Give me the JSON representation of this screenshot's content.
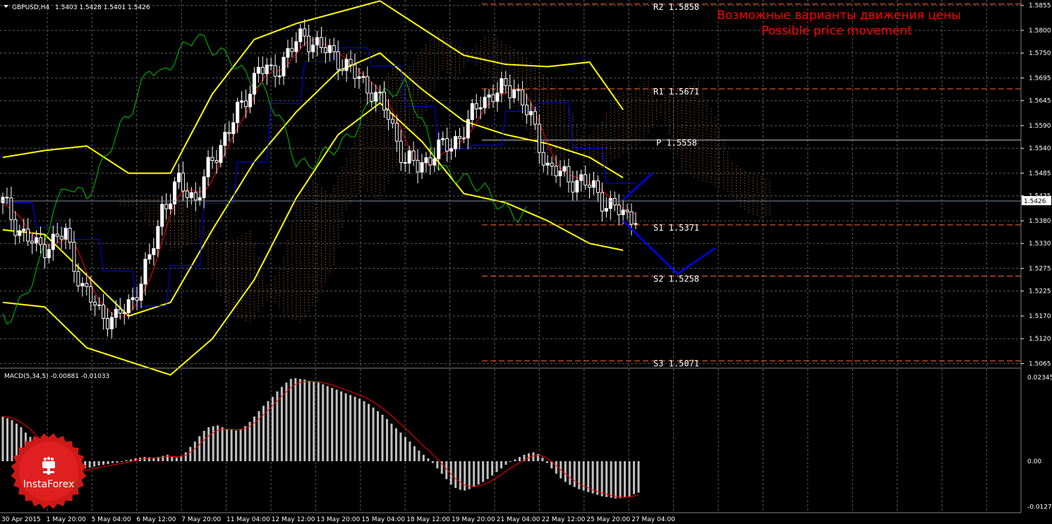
{
  "header": {
    "symbol_label": "GBPUSD,H4",
    "ohlc": "1.5403 1.5428 1.5401 1.5426",
    "dropdown_icon": "triangle-down-icon"
  },
  "annotations": {
    "title_ru": "Возможные варианты движения цены",
    "title_en": "Possible price movement",
    "color": "#ff0000"
  },
  "pivots": [
    {
      "label": "R2 1.5858",
      "value": 1.5858
    },
    {
      "label": "R1 1.5671",
      "value": 1.5671
    },
    {
      "label": "P 1.5558",
      "value": 1.5558
    },
    {
      "label": "S1 1.5371",
      "value": 1.5371
    },
    {
      "label": "S2 1.5258",
      "value": 1.5258
    },
    {
      "label": "S3 1.5071",
      "value": 1.5071
    }
  ],
  "current_price": "1.5426",
  "macd": {
    "label": "MACD(5,34,5) -0.00881 -0.01033",
    "ticks": [
      "0.02345",
      "0.00",
      "-0.0127"
    ]
  },
  "watermark": {
    "text": "InstaForex",
    "icon": "instaforex-logo-icon"
  },
  "colors": {
    "background": "#000000",
    "grid": "#5c5c5c",
    "bull_candle": "#ffffff",
    "bear_candle": "#ffffff",
    "bollinger": "#ffff00",
    "tenkan": "#ff0000",
    "kijun": "#0000ff",
    "chikou": "#00c000",
    "kumo": "#ff9966",
    "forecast": "#0000ff",
    "macd_hist": "#c0c0c0",
    "macd_signal": "#ff0000",
    "pivot": "#ff6633",
    "pivot_p": "#c0c0c0"
  },
  "chart_data": {
    "type": "line",
    "price_axis_ticks": [
      "1.5855",
      "1.5800",
      "1.5750",
      "1.5695",
      "1.5645",
      "1.5590",
      "1.5540",
      "1.5485",
      "1.5435",
      "1.5380",
      "1.5330",
      "1.5275",
      "1.5225",
      "1.5170",
      "1.5120",
      "1.5065"
    ],
    "time_axis_labels": [
      "30 Apr 2015",
      "1 May 20:00",
      "5 May 04:00",
      "6 May 12:00",
      "7 May 20:00",
      "11 May 04:00",
      "12 May 12:00",
      "13 May 20:00",
      "15 May 04:00",
      "18 May 12:00",
      "19 May 20:00",
      "21 May 04:00",
      "22 May 12:00",
      "25 May 20:00",
      "27 May 04:00"
    ],
    "ylim": [
      1.5055,
      1.5867
    ],
    "close_path": [
      [
        0,
        1.542
      ],
      [
        4,
        1.536
      ],
      [
        8,
        1.532
      ],
      [
        11,
        1.533
      ],
      [
        15,
        1.535
      ],
      [
        19,
        1.523
      ],
      [
        23,
        1.518
      ],
      [
        27,
        1.516
      ],
      [
        31,
        1.521
      ],
      [
        35,
        1.529
      ],
      [
        38,
        1.541
      ],
      [
        42,
        1.546
      ],
      [
        46,
        1.543
      ],
      [
        50,
        1.551
      ],
      [
        53,
        1.557
      ],
      [
        57,
        1.563
      ],
      [
        61,
        1.572
      ],
      [
        64,
        1.57
      ],
      [
        68,
        1.575
      ],
      [
        72,
        1.579
      ],
      [
        76,
        1.576
      ],
      [
        80,
        1.574
      ],
      [
        84,
        1.57
      ],
      [
        88,
        1.567
      ],
      [
        92,
        1.561
      ],
      [
        96,
        1.551
      ],
      [
        99,
        1.55
      ],
      [
        103,
        1.553
      ],
      [
        107,
        1.555
      ],
      [
        111,
        1.559
      ],
      [
        114,
        1.565
      ],
      [
        118,
        1.566
      ],
      [
        122,
        1.568
      ],
      [
        126,
        1.56
      ],
      [
        130,
        1.55
      ],
      [
        133,
        1.548
      ],
      [
        137,
        1.547
      ],
      [
        141,
        1.545
      ],
      [
        145,
        1.541
      ],
      [
        149,
        1.539
      ],
      [
        152,
        1.54
      ],
      [
        156,
        1.5426
      ]
    ],
    "bollinger_upper": [
      [
        0,
        1.552
      ],
      [
        10,
        1.5535
      ],
      [
        20,
        1.5545
      ],
      [
        30,
        1.5485
      ],
      [
        40,
        1.5485
      ],
      [
        50,
        1.566
      ],
      [
        60,
        1.578
      ],
      [
        70,
        1.5815
      ],
      [
        80,
        1.584
      ],
      [
        90,
        1.5865
      ],
      [
        100,
        1.5805
      ],
      [
        110,
        1.5745
      ],
      [
        120,
        1.5725
      ],
      [
        130,
        1.572
      ],
      [
        140,
        1.573
      ],
      [
        148,
        1.5625
      ]
    ],
    "bollinger_middle": [
      [
        0,
        1.536
      ],
      [
        10,
        1.535
      ],
      [
        20,
        1.526
      ],
      [
        30,
        1.517
      ],
      [
        40,
        1.52
      ],
      [
        50,
        1.536
      ],
      [
        60,
        1.551
      ],
      [
        70,
        1.562
      ],
      [
        80,
        1.571
      ],
      [
        90,
        1.575
      ],
      [
        100,
        1.567
      ],
      [
        110,
        1.56
      ],
      [
        120,
        1.557
      ],
      [
        130,
        1.555
      ],
      [
        140,
        1.552
      ],
      [
        148,
        1.5475
      ]
    ],
    "bollinger_lower": [
      [
        0,
        1.52
      ],
      [
        10,
        1.519
      ],
      [
        20,
        1.51
      ],
      [
        30,
        1.507
      ],
      [
        40,
        1.504
      ],
      [
        50,
        1.512
      ],
      [
        60,
        1.525
      ],
      [
        70,
        1.543
      ],
      [
        80,
        1.557
      ],
      [
        90,
        1.564
      ],
      [
        100,
        1.5555
      ],
      [
        110,
        1.544
      ],
      [
        120,
        1.542
      ],
      [
        130,
        1.538
      ],
      [
        140,
        1.533
      ],
      [
        148,
        1.5315
      ]
    ],
    "forecast_paths": [
      {
        "points": [
          [
            148,
            1.5426
          ],
          [
            155,
            1.5485
          ]
        ]
      },
      {
        "points": [
          [
            148,
            1.538
          ],
          [
            161,
            1.5263
          ],
          [
            170,
            1.532
          ]
        ]
      }
    ],
    "macd_histogram": [
      0.0125,
      0.012,
      0.0115,
      0.0105,
      0.0095,
      0.008,
      0.0068,
      0.005,
      0.0035,
      0.0018,
      -0.0005,
      -0.0022,
      -0.003,
      -0.004,
      -0.0045,
      -0.004,
      -0.003,
      -0.0025,
      -0.002,
      -0.0018,
      -0.0015,
      -0.0012,
      -0.001,
      -0.0008,
      -0.0005,
      -0.0004,
      -0.0002,
      0.0003,
      0.0005,
      0.0008,
      0.001,
      0.0012,
      0.0011,
      0.001,
      0.0012,
      0.0015,
      0.0018,
      0.0012,
      0.001,
      0.0015,
      0.0025,
      0.004,
      0.0055,
      0.007,
      0.0085,
      0.0095,
      0.0098,
      0.01,
      0.0095,
      0.009,
      0.0088,
      0.0086,
      0.009,
      0.0098,
      0.011,
      0.0125,
      0.014,
      0.0155,
      0.0168,
      0.018,
      0.0195,
      0.0208,
      0.022,
      0.023,
      0.0232,
      0.023,
      0.0228,
      0.0225,
      0.0222,
      0.022,
      0.0215,
      0.021,
      0.0205,
      0.02,
      0.0195,
      0.019,
      0.0185,
      0.018,
      0.0175,
      0.0168,
      0.016,
      0.015,
      0.014,
      0.013,
      0.0118,
      0.0105,
      0.0092,
      0.008,
      0.0068,
      0.0055,
      0.0042,
      0.003,
      0.0018,
      0.0008,
      -0.0005,
      -0.002,
      -0.0035,
      -0.005,
      -0.0065,
      -0.0075,
      -0.008,
      -0.0082,
      -0.0078,
      -0.0072,
      -0.0065,
      -0.0058,
      -0.005,
      -0.004,
      -0.003,
      -0.002,
      -0.001,
      -0.0002,
      0.0005,
      0.0012,
      0.0018,
      0.0022,
      0.0025,
      0.002,
      0.001,
      -0.0005,
      -0.002,
      -0.0035,
      -0.0048,
      -0.0058,
      -0.0066,
      -0.0072,
      -0.0078,
      -0.0082,
      -0.0086,
      -0.009,
      -0.0094,
      -0.0098,
      -0.01,
      -0.0102,
      -0.0104,
      -0.0103,
      -0.0101,
      -0.0098,
      -0.0092,
      -0.0088
    ]
  }
}
